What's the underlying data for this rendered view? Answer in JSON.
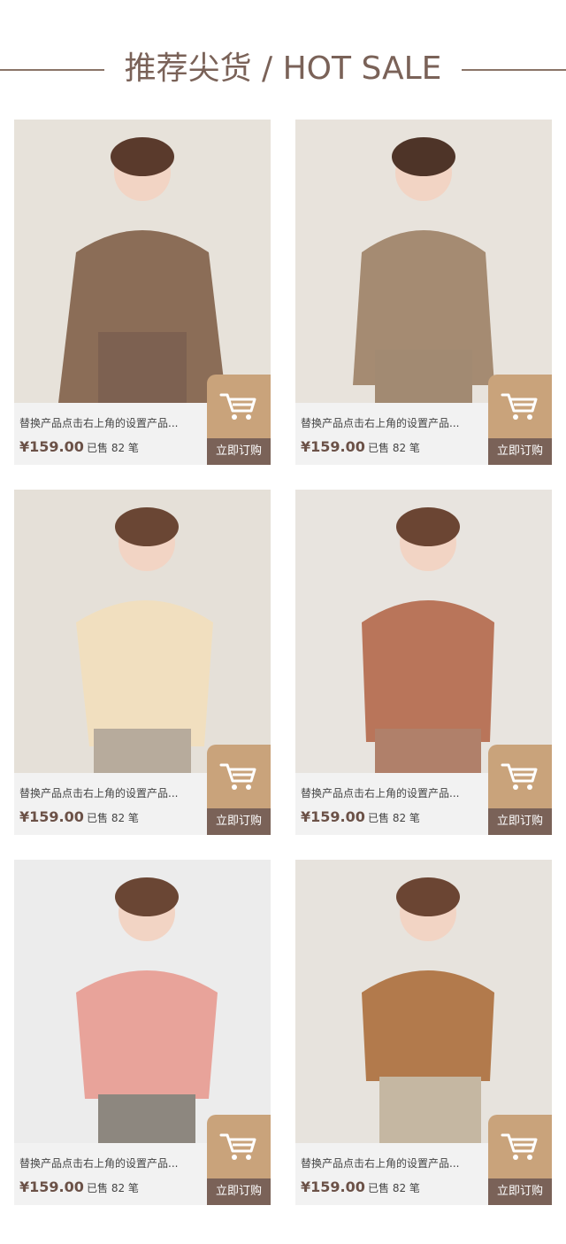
{
  "header": {
    "title": "推荐尖货 / HOT SALE"
  },
  "products": [
    {
      "name": "替换产品点击右上角的设置产品...",
      "price": "¥159.00",
      "sold": "已售 82 笔",
      "buy_label": "立即订购",
      "top_color": "#8b6d57",
      "bg_color": "#e7e2da",
      "bottom_color": "#7d6151"
    },
    {
      "name": "替换产品点击右上角的设置产品...",
      "price": "¥159.00",
      "sold": "已售 82 笔",
      "buy_label": "立即订购",
      "top_color": "#a58b72",
      "bg_color": "#e8e3dc",
      "bottom_color": "#a28a72"
    },
    {
      "name": "替换产品点击右上角的设置产品...",
      "price": "¥159.00",
      "sold": "已售 82 笔",
      "buy_label": "立即订购",
      "top_color": "#f1dfbf",
      "bg_color": "#e5e0d8",
      "bottom_color": "#b7ab9c"
    },
    {
      "name": "替换产品点击右上角的设置产品...",
      "price": "¥159.00",
      "sold": "已售 82 笔",
      "buy_label": "立即订购",
      "top_color": "#b9755a",
      "bg_color": "#e8e4df",
      "bottom_color": "#b0806a"
    },
    {
      "name": "替换产品点击右上角的设置产品...",
      "price": "¥159.00",
      "sold": "已售 82 笔",
      "buy_label": "立即订购",
      "top_color": "#e8a39a",
      "bg_color": "#ececec",
      "bottom_color": "#8d877f"
    },
    {
      "name": "替换产品点击右上角的设置产品...",
      "price": "¥159.00",
      "sold": "已售 82 笔",
      "buy_label": "立即订购",
      "top_color": "#b27a4c",
      "bg_color": "#e7e3dd",
      "bottom_color": "#c5b7a2"
    }
  ]
}
